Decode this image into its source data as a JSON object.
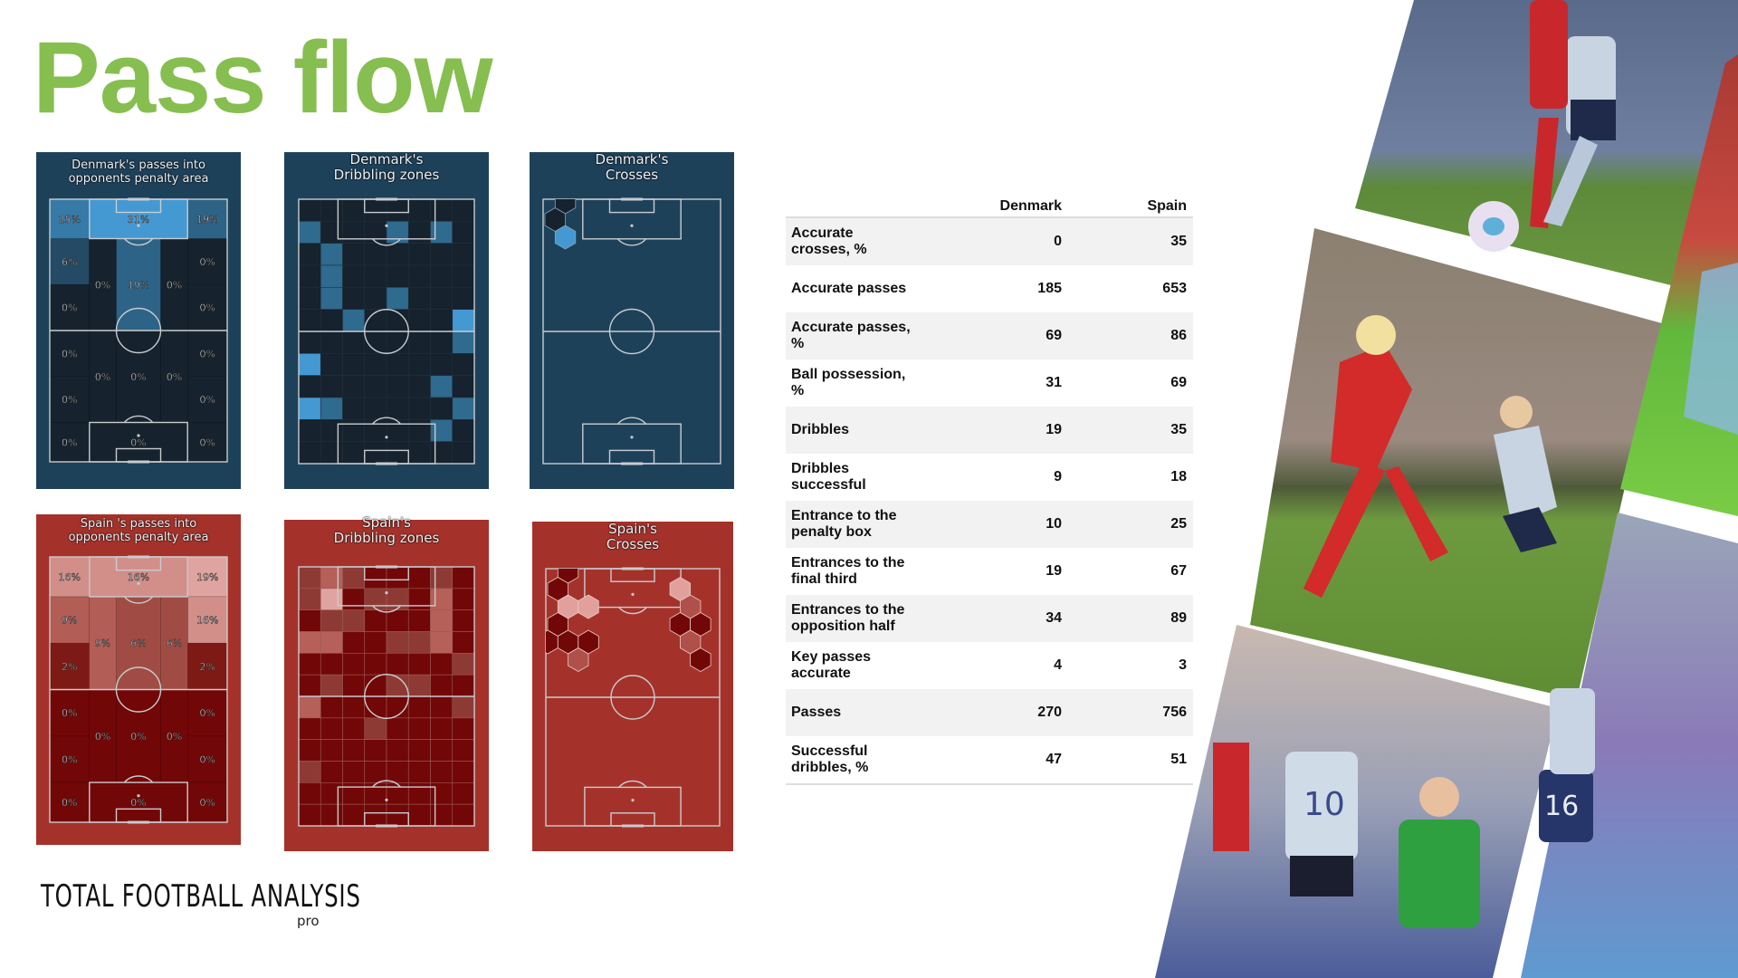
{
  "title": "Pass flow",
  "colors": {
    "title_green": "#86be50",
    "denmark_bg": "#1e415a",
    "denmark_dark": "#16222d",
    "denmark_mid": "#2f6a8f",
    "denmark_bright": "#4499d2",
    "spain_bg": "#a5322a",
    "spain_dark": "#720707",
    "spain_l1": "#8e3a34",
    "spain_l2": "#b56058",
    "spain_l3": "#e0a4a0"
  },
  "panels": {
    "denmark_passes": {
      "title_line1": "Denmark's passes into",
      "title_line2": "opponents penalty area",
      "zones": [
        {
          "id": "top-left",
          "label": "25%",
          "value": 25
        },
        {
          "id": "top-center",
          "label": "31%",
          "value": 31
        },
        {
          "id": "top-right",
          "label": "19%",
          "value": 19
        },
        {
          "id": "upper-wide-left",
          "label": "6%",
          "value": 6
        },
        {
          "id": "upper-half-left",
          "label": "0%",
          "value": 0
        },
        {
          "id": "upper-halfspace-left",
          "label": "0%",
          "value": 0
        },
        {
          "id": "upper-center",
          "label": "19%",
          "value": 19
        },
        {
          "id": "upper-halfspace-right",
          "label": "0%",
          "value": 0
        },
        {
          "id": "upper-wide-right",
          "label": "0%",
          "value": 0
        },
        {
          "id": "upper-half-right",
          "label": "0%",
          "value": 0
        },
        {
          "id": "lower-wide-left",
          "label": "0%",
          "value": 0
        },
        {
          "id": "lower-half-left",
          "label": "0%",
          "value": 0
        },
        {
          "id": "lower-halfspace-left",
          "label": "0%",
          "value": 0
        },
        {
          "id": "lower-center",
          "label": "0%",
          "value": 0
        },
        {
          "id": "lower-halfspace-right",
          "label": "0%",
          "value": 0
        },
        {
          "id": "lower-wide-right",
          "label": "0%",
          "value": 0
        },
        {
          "id": "lower-half-right",
          "label": "0%",
          "value": 0
        },
        {
          "id": "bottom-left",
          "label": "0%",
          "value": 0
        },
        {
          "id": "bottom-center",
          "label": "0%",
          "value": 0
        },
        {
          "id": "bottom-right",
          "label": "0%",
          "value": 0
        }
      ]
    },
    "spain_passes": {
      "title_line1": "Spain 's passes into",
      "title_line2": "opponents penalty area",
      "zones": [
        {
          "id": "top-left",
          "label": "16%",
          "value": 16
        },
        {
          "id": "top-center",
          "label": "16%",
          "value": 16
        },
        {
          "id": "top-right",
          "label": "19%",
          "value": 19
        },
        {
          "id": "upper-wide-left",
          "label": "9%",
          "value": 9
        },
        {
          "id": "upper-half-left",
          "label": "2%",
          "value": 2
        },
        {
          "id": "upper-halfspace-left",
          "label": "9%",
          "value": 9
        },
        {
          "id": "upper-center",
          "label": "6%",
          "value": 6
        },
        {
          "id": "upper-halfspace-right",
          "label": "6%",
          "value": 6
        },
        {
          "id": "upper-wide-right",
          "label": "16%",
          "value": 16
        },
        {
          "id": "upper-half-right",
          "label": "2%",
          "value": 2
        },
        {
          "id": "lower-wide-left",
          "label": "0%",
          "value": 0
        },
        {
          "id": "lower-half-left",
          "label": "0%",
          "value": 0
        },
        {
          "id": "lower-halfspace-left",
          "label": "0%",
          "value": 0
        },
        {
          "id": "lower-center",
          "label": "0%",
          "value": 0
        },
        {
          "id": "lower-halfspace-right",
          "label": "0%",
          "value": 0
        },
        {
          "id": "lower-wide-right",
          "label": "0%",
          "value": 0
        },
        {
          "id": "lower-half-right",
          "label": "0%",
          "value": 0
        },
        {
          "id": "bottom-left",
          "label": "0%",
          "value": 0
        },
        {
          "id": "bottom-center",
          "label": "0%",
          "value": 0
        },
        {
          "id": "bottom-right",
          "label": "0%",
          "value": 0
        }
      ]
    },
    "denmark_dribbling": {
      "title_line1": "Denmark's",
      "title_line2": "Dribbling zones",
      "grid_cols": 8,
      "grid_rows": 12,
      "intensity": [
        [
          0,
          0,
          0,
          0,
          0,
          0,
          0,
          0
        ],
        [
          1,
          0,
          0,
          0,
          1,
          0,
          1,
          0
        ],
        [
          0,
          1,
          0,
          0,
          0,
          0,
          0,
          0
        ],
        [
          0,
          1,
          0,
          0,
          0,
          0,
          0,
          0
        ],
        [
          0,
          1,
          0,
          0,
          1,
          0,
          0,
          0
        ],
        [
          0,
          0,
          1,
          0,
          0,
          0,
          0,
          2
        ],
        [
          0,
          0,
          0,
          0,
          0,
          0,
          0,
          1
        ],
        [
          2,
          0,
          0,
          0,
          0,
          0,
          0,
          0
        ],
        [
          0,
          0,
          0,
          0,
          0,
          0,
          1,
          0
        ],
        [
          2,
          1,
          0,
          0,
          0,
          0,
          0,
          1
        ],
        [
          0,
          0,
          0,
          0,
          0,
          0,
          1,
          0
        ],
        [
          0,
          0,
          0,
          0,
          0,
          0,
          0,
          0
        ]
      ]
    },
    "spain_dribbling": {
      "title_line1": "Spain's",
      "title_line2": "Dribbling zones",
      "grid_cols": 8,
      "grid_rows": 12,
      "intensity": [
        [
          1,
          2,
          1,
          0,
          0,
          0,
          1,
          0
        ],
        [
          1,
          3,
          0,
          1,
          1,
          0,
          2,
          0
        ],
        [
          0,
          1,
          1,
          0,
          0,
          0,
          2,
          0
        ],
        [
          2,
          2,
          0,
          0,
          1,
          1,
          2,
          0
        ],
        [
          0,
          0,
          0,
          0,
          0,
          0,
          0,
          1
        ],
        [
          0,
          1,
          0,
          0,
          1,
          1,
          0,
          0
        ],
        [
          2,
          0,
          0,
          0,
          0,
          0,
          0,
          1
        ],
        [
          0,
          0,
          0,
          1,
          0,
          0,
          0,
          0
        ],
        [
          0,
          0,
          0,
          0,
          0,
          0,
          0,
          0
        ],
        [
          1,
          0,
          0,
          0,
          0,
          0,
          0,
          0
        ],
        [
          0,
          0,
          0,
          0,
          0,
          0,
          0,
          0
        ],
        [
          0,
          0,
          0,
          0,
          0,
          0,
          0,
          0
        ]
      ]
    },
    "denmark_crosses": {
      "title_line1": "Denmark's",
      "title_line2": "Crosses",
      "hexes": [
        {
          "col": 1,
          "row": 0,
          "level": 0
        },
        {
          "col": 0,
          "row": 1,
          "level": 0
        },
        {
          "col": 1,
          "row": 2,
          "level": 2
        }
      ]
    },
    "spain_crosses": {
      "title_line1": "Spain's",
      "title_line2": "Crosses",
      "hexes": [
        {
          "col": 1,
          "row": 0,
          "level": 0
        },
        {
          "col": 0,
          "row": 1,
          "level": 0
        },
        {
          "col": 1,
          "row": 2,
          "level": 3
        },
        {
          "col": 3,
          "row": 2,
          "level": 3
        },
        {
          "col": 0,
          "row": 3,
          "level": 0
        },
        {
          "col": -1,
          "row": 4,
          "level": 0
        },
        {
          "col": 1,
          "row": 4,
          "level": 0
        },
        {
          "col": 3,
          "row": 4,
          "level": 0
        },
        {
          "col": 2,
          "row": 5,
          "level": 2
        },
        {
          "col": 12,
          "row": 1,
          "level": 3
        },
        {
          "col": 13,
          "row": 2,
          "level": 2
        },
        {
          "col": 12,
          "row": 3,
          "level": 0
        },
        {
          "col": 14,
          "row": 3,
          "level": 0
        },
        {
          "col": 13,
          "row": 4,
          "level": 2
        },
        {
          "col": 14,
          "row": 5,
          "level": 0
        }
      ]
    }
  },
  "stats_table": {
    "headers": [
      "",
      "Denmark",
      "Spain"
    ],
    "rows": [
      {
        "metric_line1": "Accurate",
        "metric_line2": "crosses, %",
        "denmark": "0",
        "spain": "35"
      },
      {
        "metric_line1": "Accurate passes",
        "metric_line2": "",
        "denmark": "185",
        "spain": "653"
      },
      {
        "metric_line1": "Accurate passes,",
        "metric_line2": "%",
        "denmark": "69",
        "spain": "86"
      },
      {
        "metric_line1": "Ball possession,",
        "metric_line2": "%",
        "denmark": "31",
        "spain": "69"
      },
      {
        "metric_line1": "Dribbles",
        "metric_line2": "",
        "denmark": "19",
        "spain": "35"
      },
      {
        "metric_line1": "Dribbles",
        "metric_line2": "successful",
        "denmark": "9",
        "spain": "18"
      },
      {
        "metric_line1": "Entrance to the",
        "metric_line2": "penalty box",
        "denmark": "10",
        "spain": "25"
      },
      {
        "metric_line1": "Entrances to the",
        "metric_line2": "final third",
        "denmark": "19",
        "spain": "67"
      },
      {
        "metric_line1": "Entrances to the",
        "metric_line2": "opposition half",
        "denmark": "34",
        "spain": "89"
      },
      {
        "metric_line1": "Key passes",
        "metric_line2": "accurate",
        "denmark": "4",
        "spain": "3"
      },
      {
        "metric_line1": "Passes",
        "metric_line2": "",
        "denmark": "270",
        "spain": "756"
      },
      {
        "metric_line1": "Successful",
        "metric_line2": "dribbles, %",
        "denmark": "47",
        "spain": "51"
      }
    ]
  },
  "logo": {
    "main": "TOTAL FOOTBALL ANALYSIS",
    "sub": "pro"
  },
  "photos": [
    {
      "id": "photo-top",
      "subject": "Spain number 10 dribbling ball past Denmark player"
    },
    {
      "id": "photo-middle",
      "subject": "Denmark captain shooting while Spain player blocks"
    },
    {
      "id": "photo-bottom",
      "subject": "Spain number 10 in front of goal with Denmark goalkeeper"
    },
    {
      "id": "photo-right-top",
      "subject": "Denmark and Spain players legs close-up"
    },
    {
      "id": "photo-right-bottom",
      "subject": "Spain number 16 running"
    }
  ]
}
